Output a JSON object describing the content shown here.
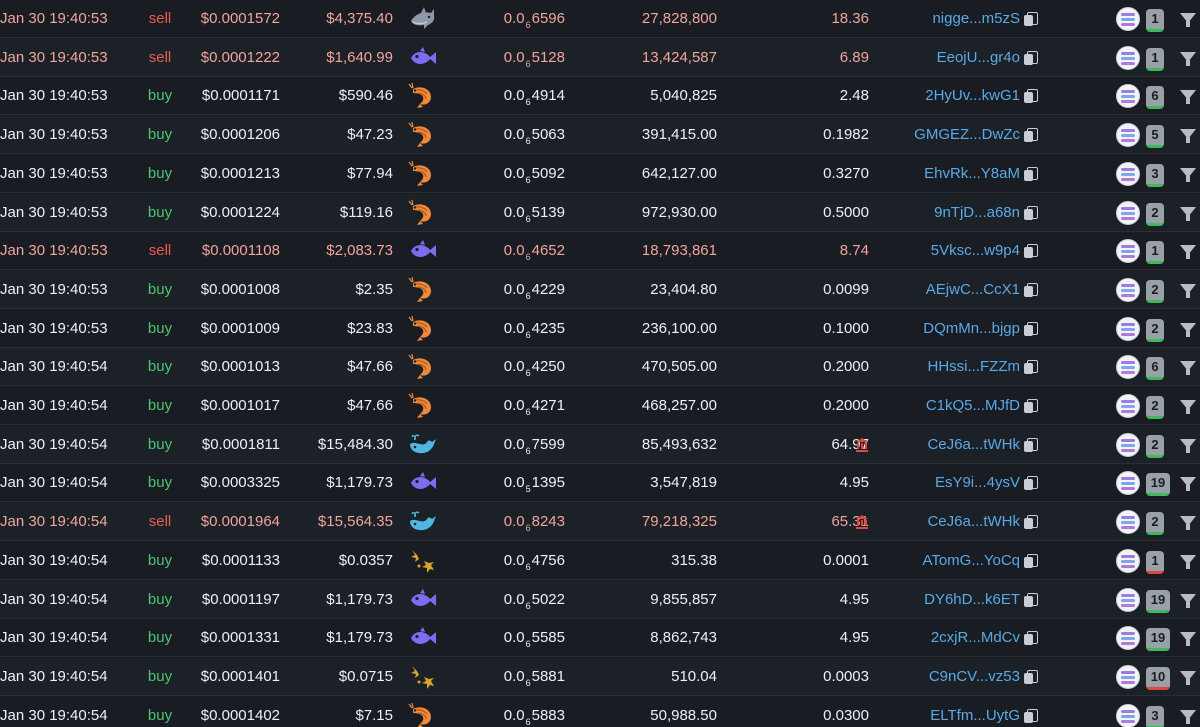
{
  "rows": [
    {
      "time": "Jan 30 19:40:53",
      "type": "sell",
      "price": "$0.0001572",
      "total": "$4,375.40",
      "icon": "shark-icon",
      "mcap_pre": "0.0",
      "mcap_sub": "6",
      "mcap_post": "6596",
      "amount": "27,828,800",
      "sol": "18.36",
      "bank": false,
      "maker": "nigge...m5zS",
      "badge": "1",
      "badge_status": "green"
    },
    {
      "time": "Jan 30 19:40:53",
      "type": "sell",
      "price": "$0.0001222",
      "total": "$1,640.99",
      "icon": "fish-icon",
      "mcap_pre": "0.0",
      "mcap_sub": "6",
      "mcap_post": "5128",
      "amount": "13,424,587",
      "sol": "6.89",
      "bank": false,
      "maker": "EeojU...gr4o",
      "badge": "1",
      "badge_status": "green"
    },
    {
      "time": "Jan 30 19:40:53",
      "type": "buy",
      "price": "$0.0001171",
      "total": "$590.46",
      "icon": "shrimp-icon",
      "mcap_pre": "0.0",
      "mcap_sub": "6",
      "mcap_post": "4914",
      "amount": "5,040,825",
      "sol": "2.48",
      "bank": false,
      "maker": "2HyUv...kwG1",
      "badge": "6",
      "badge_status": "green"
    },
    {
      "time": "Jan 30 19:40:53",
      "type": "buy",
      "price": "$0.0001206",
      "total": "$47.23",
      "icon": "shrimp-icon",
      "mcap_pre": "0.0",
      "mcap_sub": "6",
      "mcap_post": "5063",
      "amount": "391,415.00",
      "sol": "0.1982",
      "bank": false,
      "maker": "GMGEZ...DwZc",
      "badge": "5",
      "badge_status": "green"
    },
    {
      "time": "Jan 30 19:40:53",
      "type": "buy",
      "price": "$0.0001213",
      "total": "$77.94",
      "icon": "shrimp-icon",
      "mcap_pre": "0.0",
      "mcap_sub": "6",
      "mcap_post": "5092",
      "amount": "642,127.00",
      "sol": "0.3270",
      "bank": false,
      "maker": "EhvRk...Y8aM",
      "badge": "3",
      "badge_status": "green"
    },
    {
      "time": "Jan 30 19:40:53",
      "type": "buy",
      "price": "$0.0001224",
      "total": "$119.16",
      "icon": "shrimp-icon",
      "mcap_pre": "0.0",
      "mcap_sub": "6",
      "mcap_post": "5139",
      "amount": "972,930.00",
      "sol": "0.5000",
      "bank": false,
      "maker": "9nTjD...a68n",
      "badge": "2",
      "badge_status": "green"
    },
    {
      "time": "Jan 30 19:40:53",
      "type": "sell",
      "price": "$0.0001108",
      "total": "$2,083.73",
      "icon": "fish-icon",
      "mcap_pre": "0.0",
      "mcap_sub": "6",
      "mcap_post": "4652",
      "amount": "18,793,861",
      "sol": "8.74",
      "bank": false,
      "maker": "5Vksc...w9p4",
      "badge": "1",
      "badge_status": "green"
    },
    {
      "time": "Jan 30 19:40:53",
      "type": "buy",
      "price": "$0.0001008",
      "total": "$2.35",
      "icon": "shrimp-icon",
      "mcap_pre": "0.0",
      "mcap_sub": "6",
      "mcap_post": "4229",
      "amount": "23,404.80",
      "sol": "0.0099",
      "bank": false,
      "maker": "AEjwC...CcX1",
      "badge": "2",
      "badge_status": "green"
    },
    {
      "time": "Jan 30 19:40:53",
      "type": "buy",
      "price": "$0.0001009",
      "total": "$23.83",
      "icon": "shrimp-icon",
      "mcap_pre": "0.0",
      "mcap_sub": "6",
      "mcap_post": "4235",
      "amount": "236,100.00",
      "sol": "0.1000",
      "bank": false,
      "maker": "DQmMn...bjgp",
      "badge": "2",
      "badge_status": "green"
    },
    {
      "time": "Jan 30 19:40:54",
      "type": "buy",
      "price": "$0.0001013",
      "total": "$47.66",
      "icon": "shrimp-icon",
      "mcap_pre": "0.0",
      "mcap_sub": "6",
      "mcap_post": "4250",
      "amount": "470,505.00",
      "sol": "0.2000",
      "bank": false,
      "maker": "HHssi...FZZm",
      "badge": "6",
      "badge_status": "green"
    },
    {
      "time": "Jan 30 19:40:54",
      "type": "buy",
      "price": "$0.0001017",
      "total": "$47.66",
      "icon": "shrimp-icon",
      "mcap_pre": "0.0",
      "mcap_sub": "6",
      "mcap_post": "4271",
      "amount": "468,257.00",
      "sol": "0.2000",
      "bank": false,
      "maker": "C1kQ5...MJfD",
      "badge": "2",
      "badge_status": "green"
    },
    {
      "time": "Jan 30 19:40:54",
      "type": "buy",
      "price": "$0.0001811",
      "total": "$15,484.30",
      "icon": "whale-icon",
      "mcap_pre": "0.0",
      "mcap_sub": "6",
      "mcap_post": "7599",
      "amount": "85,493,632",
      "sol": "64.97",
      "bank": true,
      "maker": "CeJ6a...tWHk",
      "badge": "2",
      "badge_status": "green"
    },
    {
      "time": "Jan 30 19:40:54",
      "type": "buy",
      "price": "$0.0003325",
      "total": "$1,179.73",
      "icon": "fish-icon",
      "mcap_pre": "0.0",
      "mcap_sub": "5",
      "mcap_post": "1395",
      "amount": "3,547,819",
      "sol": "4.95",
      "bank": false,
      "maker": "EsY9i...4ysV",
      "badge": "19",
      "badge_status": "green"
    },
    {
      "time": "Jan 30 19:40:54",
      "type": "sell",
      "price": "$0.0001964",
      "total": "$15,564.35",
      "icon": "whale-icon",
      "mcap_pre": "0.0",
      "mcap_sub": "6",
      "mcap_post": "8243",
      "amount": "79,218,325",
      "sol": "65.31",
      "bank": true,
      "maker": "CeJ6a...tWHk",
      "badge": "2",
      "badge_status": "green"
    },
    {
      "time": "Jan 30 19:40:54",
      "type": "buy",
      "price": "$0.0001133",
      "total": "$0.0357",
      "icon": "plankton-icon",
      "mcap_pre": "0.0",
      "mcap_sub": "6",
      "mcap_post": "4756",
      "amount": "315.38",
      "sol": "0.0001",
      "bank": false,
      "maker": "ATomG...YoCq",
      "badge": "1",
      "badge_status": "red"
    },
    {
      "time": "Jan 30 19:40:54",
      "type": "buy",
      "price": "$0.0001197",
      "total": "$1,179.73",
      "icon": "fish-icon",
      "mcap_pre": "0.0",
      "mcap_sub": "6",
      "mcap_post": "5022",
      "amount": "9,855,857",
      "sol": "4.95",
      "bank": false,
      "maker": "DY6hD...k6ET",
      "badge": "19",
      "badge_status": "green"
    },
    {
      "time": "Jan 30 19:40:54",
      "type": "buy",
      "price": "$0.0001331",
      "total": "$1,179.73",
      "icon": "fish-icon",
      "mcap_pre": "0.0",
      "mcap_sub": "6",
      "mcap_post": "5585",
      "amount": "8,862,743",
      "sol": "4.95",
      "bank": false,
      "maker": "2cxjR...MdCv",
      "badge": "19",
      "badge_status": "green"
    },
    {
      "time": "Jan 30 19:40:54",
      "type": "buy",
      "price": "$0.0001401",
      "total": "$0.0715",
      "icon": "plankton-icon",
      "mcap_pre": "0.0",
      "mcap_sub": "6",
      "mcap_post": "5881",
      "amount": "510.04",
      "sol": "0.0003",
      "bank": false,
      "maker": "C9nCV...vz53",
      "badge": "10",
      "badge_status": "red"
    },
    {
      "time": "Jan 30 19:40:54",
      "type": "buy",
      "price": "$0.0001402",
      "total": "$7.15",
      "icon": "shrimp-icon",
      "mcap_pre": "0.0",
      "mcap_sub": "6",
      "mcap_post": "5883",
      "amount": "50,988.50",
      "sol": "0.0300",
      "bank": false,
      "maker": "ELTfm...UytG",
      "badge": "3",
      "badge_status": "green"
    }
  ],
  "colors": {
    "background": "#191c22",
    "buy": "#4cc56e",
    "sell": "#ef5a4f",
    "sell_text": "#f1a59c",
    "maker_link": "#5aa9e6"
  }
}
